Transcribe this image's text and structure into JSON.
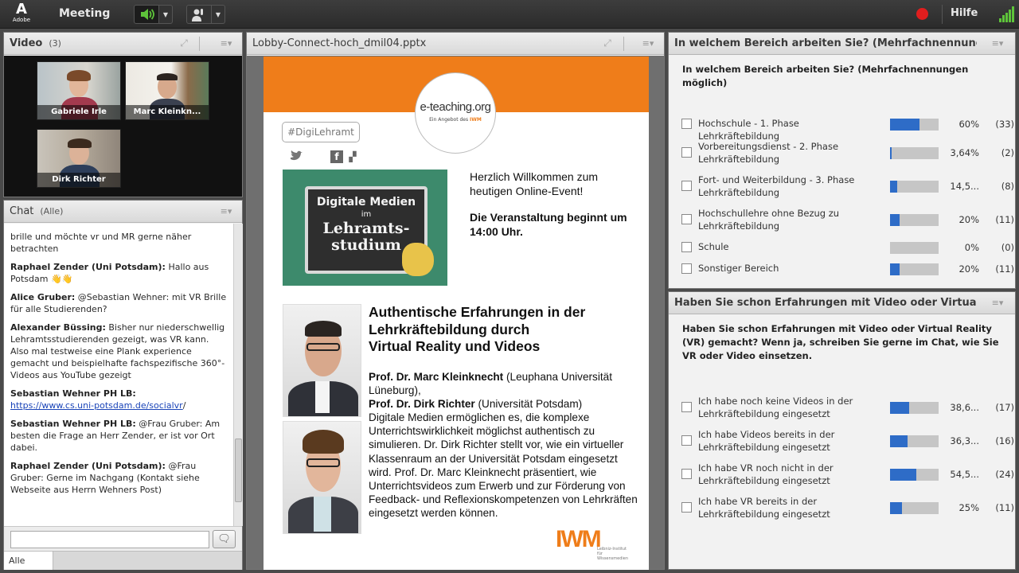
{
  "app": {
    "brand": "Adobe",
    "menu_meeting": "Meeting",
    "help": "Hilfe",
    "colors": {
      "accent": "#2e6cc7",
      "record": "#e01e1e",
      "signal": "#5ec43a",
      "slide_orange": "#ef7d1a"
    }
  },
  "video": {
    "title": "Video",
    "count": "(3)",
    "participants": [
      "Gabriele Irle",
      "Marc Kleinkn...",
      "Dirk Richter"
    ]
  },
  "chat": {
    "title": "Chat",
    "scope": "(Alle)",
    "messages": [
      {
        "sender": "",
        "text": "brille und möchte vr und MR gerne näher betrachten"
      },
      {
        "sender": "Raphael Zender (Uni Potsdam):",
        "text": " Hallo aus Potsdam 👋👋"
      },
      {
        "sender": "Alice Gruber:",
        "text": " @Sebastian Wehner: mit VR Brille für alle Studierenden?"
      },
      {
        "sender": "Alexander Büssing:",
        "text": " Bisher nur niederschwellig Lehramtsstudierenden gezeigt, was VR kann. Also mal testweise eine Plank experience gemacht und beispielhafte fachspezifische 360°-Videos aus YouTube gezeigt"
      },
      {
        "sender": "Sebastian Wehner PH LB:",
        "link": "https://www.cs.uni-potsdam.de/socialvr",
        "text": "/"
      },
      {
        "sender": "Sebastian Wehner PH LB:",
        "text": " @Frau Gruber: Am besten die Frage an Herr Zender, er ist vor Ort dabei."
      },
      {
        "sender": "Raphael Zender (Uni Potsdam):",
        "text": " @Frau Gruber: Gerne im Nachgang (Kontakt siehe Webseite aus Herrn Wehners Post)"
      }
    ],
    "input_placeholder": "",
    "tab_label": "Alle"
  },
  "share": {
    "title": "Lobby-Connect-hoch_dmil04.pptx",
    "slide": {
      "logo_main": "e-teaching.org",
      "logo_sub": "Ein Angebot des",
      "logo_sub_brand": "IWM",
      "hashtag": "#DigiLehramt",
      "board_line1": "Digitale Medien",
      "board_line2": "im",
      "board_line3": "Lehramts-",
      "board_line4": "studium",
      "welcome": "Herzlich Willkommen zum heutigen Online-Event!",
      "start": "Die Veranstaltung beginnt um 14:00 Uhr.",
      "title_l1": "Authentische Erfahrungen in der",
      "title_l2": "Lehrkräftebildung durch",
      "title_l3": "Virtual Reality und Videos",
      "prof1_name": "Prof. Dr. Marc Kleinknecht",
      "prof1_aff": " (Leuphana Universität Lüneburg),",
      "prof2_name": "Prof. Dr. Dirk Richter",
      "prof2_aff": " (Universität Potsdam)",
      "description": "Digitale Medien ermöglichen es, die komplexe Unterrichtswirklichkeit möglichst authentisch zu simulieren. Dr. Dirk Richter stellt vor, wie ein virtueller Klassenraum an der Universität Potsdam eingesetzt wird. Prof. Dr. Marc Kleinknecht präsentiert, wie Unterrichtsvideos zum Erwerb und zur Förderung von Feedback- und Reflexionskompetenzen von Lehrkräften eingesetzt werden können.",
      "iwm": "IWM",
      "iwm_sub": "Leibniz-Institut für Wissensmedien"
    }
  },
  "poll1": {
    "title": "In welchem Bereich arbeiten Sie? (Mehrfachnennungen m...",
    "question": "In welchem Bereich arbeiten Sie? (Mehrfachnennungen möglich)",
    "options": [
      {
        "label": "Hochschule - 1. Phase Lehrkräftebildung",
        "pct": "60%",
        "count": "(33)",
        "fraction": 0.6
      },
      {
        "label": "Vorbereitungsdienst - 2. Phase Lehrkräftebildung",
        "pct": "3,64%",
        "count": "(2)",
        "fraction": 0.0364
      },
      {
        "label": "Fort- und Weiterbildung - 3. Phase Lehrkräftebildung",
        "pct": "14,5...",
        "count": "(8)",
        "fraction": 0.145
      },
      {
        "label": "Hochschullehre ohne Bezug zu Lehrkräftebildung",
        "pct": "20%",
        "count": "(11)",
        "fraction": 0.2
      },
      {
        "label": "Schule",
        "pct": "0%",
        "count": "(0)",
        "fraction": 0.0
      },
      {
        "label": "Sonstiger Bereich",
        "pct": "20%",
        "count": "(11)",
        "fraction": 0.2
      }
    ]
  },
  "poll2": {
    "title": "Haben Sie schon Erfahrungen mit Video oder Virtual Realit...",
    "question": "Haben Sie schon Erfahrungen mit Video oder Virtual Reality (VR) gemacht? Wenn ja, schreiben Sie gerne im Chat, wie Sie VR oder Video einsetzen.",
    "options": [
      {
        "label": "Ich habe noch keine Videos in der Lehrkräftebildung eingesetzt",
        "pct": "38,6...",
        "count": "(17)",
        "fraction": 0.386
      },
      {
        "label": "Ich habe Videos bereits in der Lehrkräftebildung eingesetzt",
        "pct": "36,3...",
        "count": "(16)",
        "fraction": 0.363
      },
      {
        "label": "Ich habe VR noch nicht in der Lehrkräftebildung eingesetzt",
        "pct": "54,5...",
        "count": "(24)",
        "fraction": 0.545
      },
      {
        "label": "Ich habe VR bereits in der Lehrkräftebildung eingesetzt",
        "pct": "25%",
        "count": "(11)",
        "fraction": 0.25
      }
    ]
  }
}
